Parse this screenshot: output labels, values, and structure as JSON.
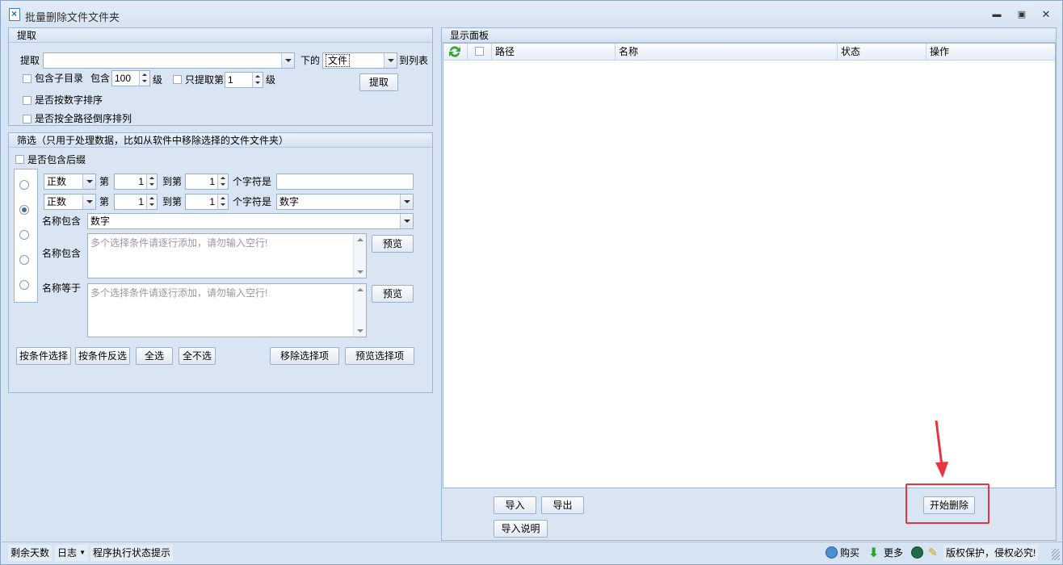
{
  "window": {
    "title": "批量删除文件文件夹"
  },
  "extract": {
    "header": "提取",
    "source_label": "提取",
    "source_value": "",
    "under_label": "下的",
    "type_value": "文件",
    "to_list_label": "到列表",
    "include_subdirs_label": "包含子目录",
    "include_label": "包含",
    "depth_value": "100",
    "level_label": "级",
    "only_extract_label": "只提取第",
    "only_level_value": "1",
    "level_label2": "级",
    "extract_button": "提取",
    "numeric_sort_label": "是否按数字排序",
    "full_path_reverse_label": "是否按全路径倒序排列"
  },
  "filter": {
    "header": "筛选（只用于处理数据，比如从软件中移除选择的文件文件夹）",
    "include_suffix_label": "是否包含后缀",
    "row1": {
      "sign": "正数",
      "nth_label": "第",
      "from": "1",
      "to_label": "到第",
      "to": "1",
      "char_label": "个字符是",
      "value": ""
    },
    "row2": {
      "sign": "正数",
      "nth_label": "第",
      "from": "1",
      "to_label": "到第",
      "to": "1",
      "char_label": "个字符是",
      "value": "数字"
    },
    "name_contains_label": "名称包含",
    "name_contains_value": "数字",
    "name_contains_multi_label": "名称包含",
    "name_contains_multi_placeholder": "多个选择条件请逐行添加，请勿输入空行!",
    "name_equals_label": "名称等于",
    "name_equals_placeholder": "多个选择条件请逐行添加，请勿输入空行!",
    "preview_button": "预览",
    "preview_button2": "预览",
    "select_by_condition": "按条件选择",
    "invert_by_condition": "按条件反选",
    "select_all": "全选",
    "select_none": "全不选",
    "remove_selected": "移除选择项",
    "preview_selected": "预览选择项"
  },
  "display": {
    "header": "显示面板",
    "columns": [
      "路径",
      "名称",
      "状态",
      "操作"
    ],
    "import_button": "导入",
    "export_button": "导出",
    "import_help_button": "导入说明",
    "start_delete_button": "开始删除"
  },
  "status": {
    "days_left": "剩余天数",
    "log": "日志",
    "status_hint": "程序执行状态提示",
    "buy": "购买",
    "more": "更多",
    "copyright": "版权保护，侵权必究!"
  },
  "colors": {
    "accent_red": "#e8343f",
    "panel_bg": "#d9e5f3"
  }
}
